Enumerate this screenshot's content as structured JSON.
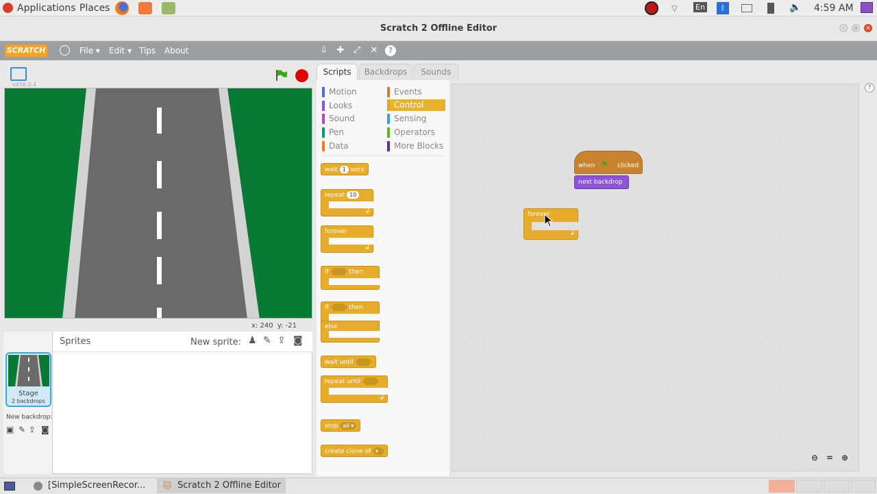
{
  "system_bar": {
    "applications": "Applications",
    "places": "Places",
    "language": "En",
    "time": "4:59 AM"
  },
  "window": {
    "title": "Scratch 2 Offline Editor"
  },
  "menubar": {
    "logo": "SCRATCH",
    "file": "File",
    "edit": "Edit",
    "tips": "Tips",
    "about": "About"
  },
  "stage": {
    "version": "v456.0.4",
    "coords_x": "x: 240",
    "coords_y": "y: -21"
  },
  "sprites": {
    "header": "Sprites",
    "new_sprite": "New sprite:",
    "stage_label": "Stage",
    "stage_count": "2 backdrops",
    "new_backdrop": "New backdrop:"
  },
  "tabs": {
    "scripts": "Scripts",
    "backdrops": "Backdrops",
    "sounds": "Sounds"
  },
  "categories": [
    {
      "label": "Motion",
      "color": "#4a6cd4"
    },
    {
      "label": "Looks",
      "color": "#8a55d7"
    },
    {
      "label": "Sound",
      "color": "#bb42c3"
    },
    {
      "label": "Pen",
      "color": "#0e9a6c"
    },
    {
      "label": "Data",
      "color": "#ee7d16"
    },
    {
      "label": "Events",
      "color": "#c88330"
    },
    {
      "label": "Control",
      "color": "#e1a91a"
    },
    {
      "label": "Sensing",
      "color": "#2ca5e2"
    },
    {
      "label": "Operators",
      "color": "#5cb712"
    },
    {
      "label": "More Blocks",
      "color": "#632d99"
    }
  ],
  "palette": {
    "wait": "wait",
    "wait_val": "1",
    "secs": "secs",
    "repeat": "repeat",
    "repeat_val": "10",
    "forever": "forever",
    "if": "if",
    "then": "then",
    "if2": "if",
    "then2": "then",
    "else": "else",
    "wait_until": "wait until",
    "repeat_until": "repeat until",
    "stop": "stop",
    "stop_val": "all",
    "create_clone": "create clone of"
  },
  "script": {
    "when": "when",
    "clicked": "clicked",
    "next_backdrop": "next backdrop",
    "forever": "forever"
  },
  "taskbar": {
    "task1": "[SimpleScreenRecor...",
    "task2": "Scratch 2 Offline Editor"
  }
}
